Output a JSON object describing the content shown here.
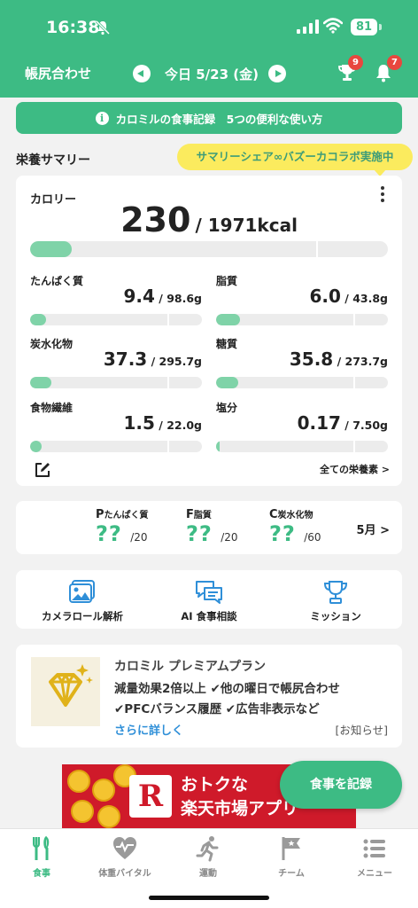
{
  "status_bar": {
    "time": "16:38",
    "battery": "81"
  },
  "header": {
    "left_label": "帳尻合わせ",
    "date": "今日 5/23 (金)",
    "trophy_badge": "9",
    "bell_badge": "7",
    "color": "#3dbb84"
  },
  "banner": {
    "text": "カロミルの食事記録　5つの便利な使い方",
    "icon": "info-icon"
  },
  "summary": {
    "title": "栄養サマリー",
    "promo": "サマリーシェア∞バズーカコラボ実施中",
    "calorie": {
      "label": "カロリー",
      "value": "230",
      "goal": "/ 1971kcal",
      "ratio": 0.117
    },
    "nutrients": [
      {
        "label": "たんぱく質",
        "value": "9.4",
        "goal": " / 98.6g",
        "ratio": 0.095
      },
      {
        "label": "脂質",
        "value": "6.0",
        "goal": " / 43.8g",
        "ratio": 0.137
      },
      {
        "label": "炭水化物",
        "value": "37.3",
        "goal": " / 295.7g",
        "ratio": 0.126
      },
      {
        "label": "糖質",
        "value": "35.8",
        "goal": " / 273.7g",
        "ratio": 0.131
      },
      {
        "label": "食物繊維",
        "value": "1.5",
        "goal": " / 22.0g",
        "ratio": 0.068
      },
      {
        "label": "塩分",
        "value": "0.17",
        "goal": " / 7.50g",
        "ratio": 0.023
      }
    ],
    "all_nutrients_link": "全ての栄養素 >"
  },
  "pfc": {
    "items": [
      {
        "letter": "P",
        "name": "たんぱく質",
        "value": "??",
        "goal": "/20"
      },
      {
        "letter": "F",
        "name": "脂質",
        "value": "??",
        "goal": "/20"
      },
      {
        "letter": "C",
        "name": "炭水化物",
        "value": "??",
        "goal": "/60"
      }
    ],
    "month": "5月 >"
  },
  "tools": [
    {
      "label": "カメラロール解析",
      "icon": "photo-icon"
    },
    {
      "label": "AI 食事相談",
      "icon": "chat-icon"
    },
    {
      "label": "ミッション",
      "icon": "trophy-icon"
    }
  ],
  "premium": {
    "title": "カロミル プレミアムプラン",
    "line1": "減量効果2倍以上 ✔他の曜日で帳尻合わせ",
    "line2": "✔PFCバランス履歴 ✔広告非表示など",
    "more": "さらに詳しく",
    "notice": "[お知らせ]",
    "icon": "diamond-icon"
  },
  "ad": {
    "logo": "R",
    "line1": "おトクな",
    "line2": "楽天市場アプリ"
  },
  "fab": {
    "label": "食事を記録"
  },
  "tabbar": [
    {
      "label": "食事",
      "icon": "meal-icon",
      "active": true
    },
    {
      "label": "体重バイタル",
      "icon": "heart-icon",
      "active": false
    },
    {
      "label": "運動",
      "icon": "run-icon",
      "active": false
    },
    {
      "label": "チーム",
      "icon": "flag-icon",
      "active": false
    },
    {
      "label": "メニュー",
      "icon": "menu-icon",
      "active": false
    }
  ]
}
